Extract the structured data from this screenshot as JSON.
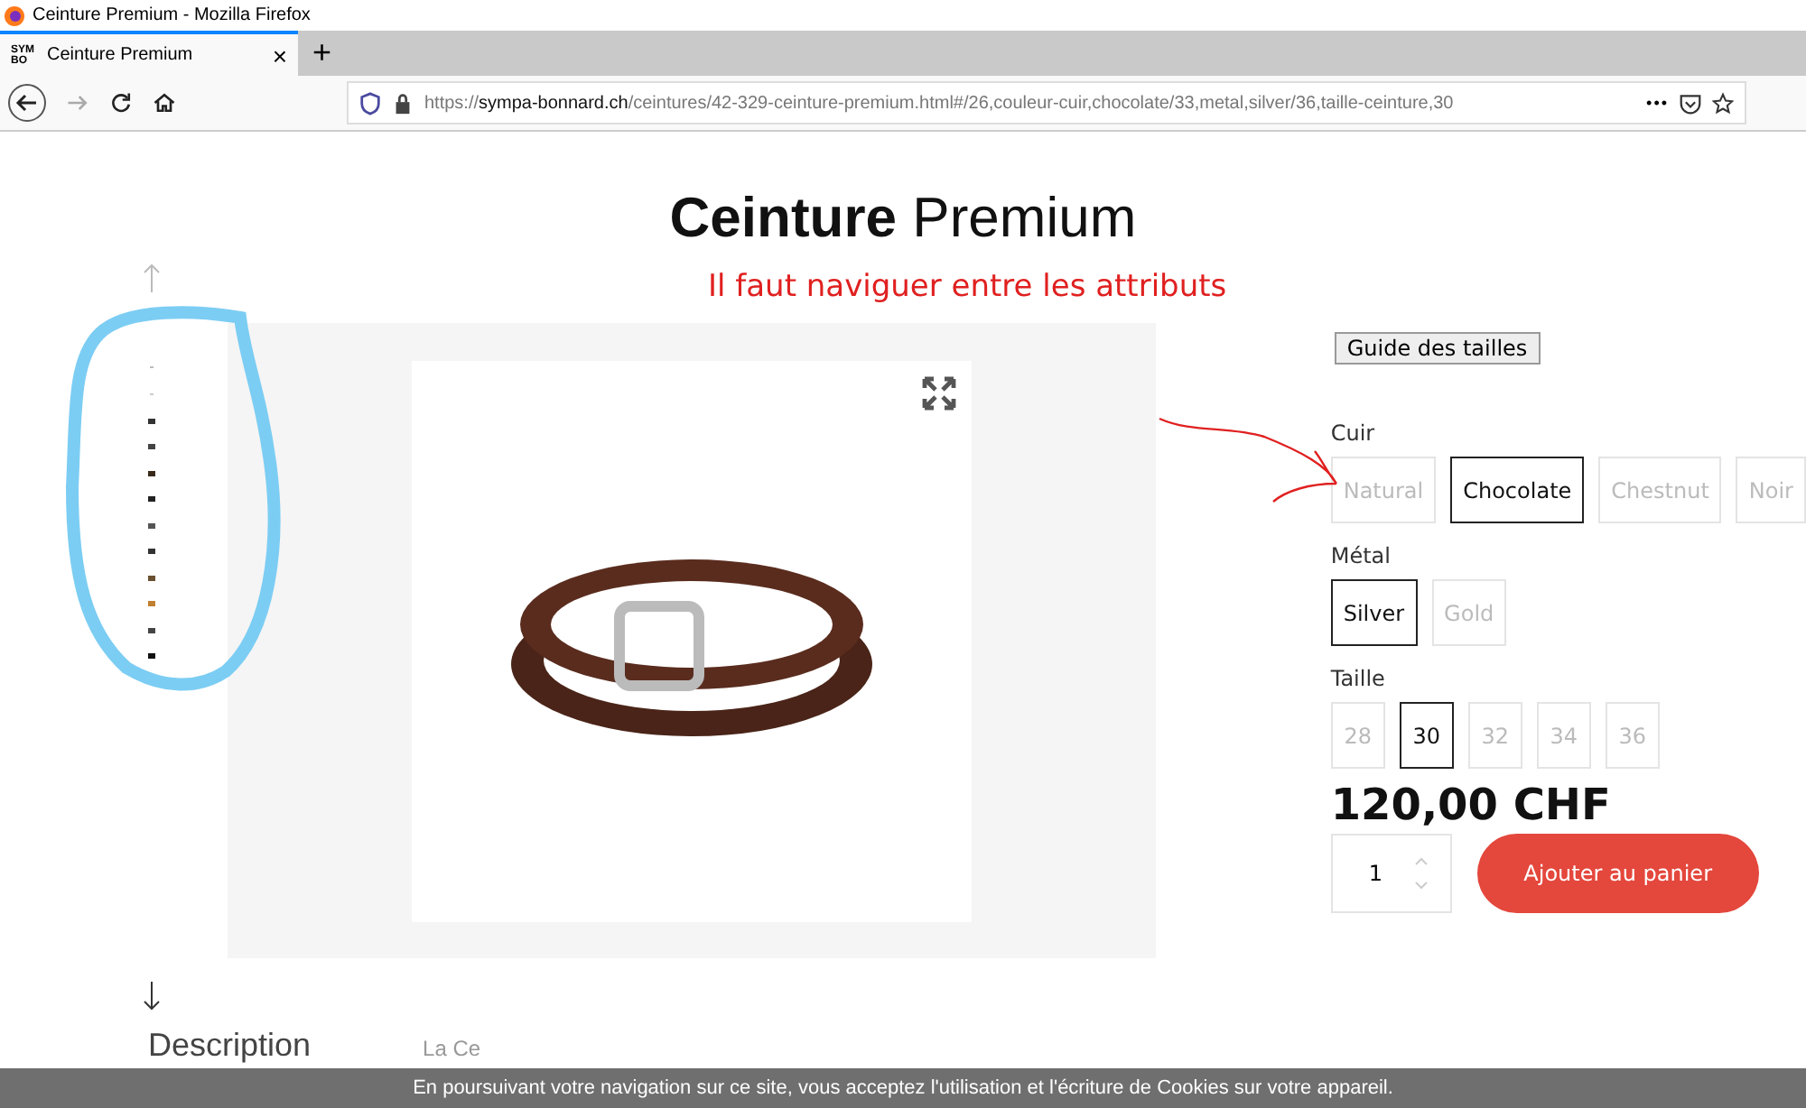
{
  "window": {
    "title": "Ceinture Premium - Mozilla Firefox"
  },
  "tab": {
    "favicon_text": "SYM BO",
    "title": "Ceinture Premium",
    "close": "×",
    "new_tab": "+"
  },
  "address_bar": {
    "url_scheme": "https://",
    "url_host": "sympa-bonnard.ch",
    "url_path": "/ceintures/42-329-ceinture-premium.html#/26,couleur-cuir,chocolate/33,metal,silver/36,taille-ceinture,30",
    "more": "•••"
  },
  "product": {
    "title": "**Ceinture** Premium",
    "size_guide": "Guide des tailles",
    "attributes": [
      {
        "label": "Cuir",
        "options": [
          {
            "label": "Natural",
            "selected": false
          },
          {
            "label": "Chocolate",
            "selected": true
          },
          {
            "label": "Chestnut",
            "selected": false
          },
          {
            "label": "Noir",
            "selected": false
          }
        ]
      },
      {
        "label": "Métal",
        "options": [
          {
            "label": "Silver",
            "selected": true
          },
          {
            "label": "Gold",
            "selected": false
          }
        ]
      },
      {
        "label": "Taille",
        "options": [
          {
            "label": "28",
            "selected": false
          },
          {
            "label": "30",
            "selected": true
          },
          {
            "label": "32",
            "selected": false
          },
          {
            "label": "34",
            "selected": false
          },
          {
            "label": "36",
            "selected": false
          }
        ]
      }
    ],
    "price": "120,00 CHF",
    "quantity": "1",
    "add_to_cart": "Ajouter au panier",
    "description_heading": "Description",
    "description_text": "La Ce"
  },
  "annotation": {
    "text": "Il faut naviguer entre les attributs"
  },
  "cookie_banner": {
    "text": "En poursuivant votre navigation sur ce site, vous acceptez l'utilisation et l'écriture de Cookies sur votre appareil."
  }
}
